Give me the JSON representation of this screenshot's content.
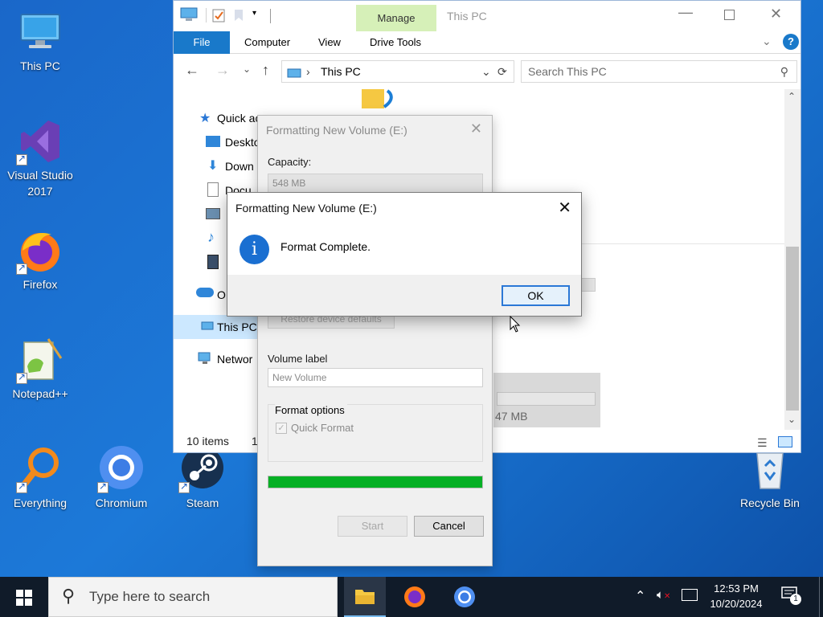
{
  "desktop": {
    "icons": [
      {
        "label": "This PC"
      },
      {
        "label": "Visual Studio\n2017"
      },
      {
        "label": "Firefox"
      },
      {
        "label": "Notepad++"
      },
      {
        "label": "Everything"
      },
      {
        "label": "Chromium"
      },
      {
        "label": "Steam"
      },
      {
        "label": "Recycle Bin"
      }
    ]
  },
  "explorer": {
    "title": "This PC",
    "manage_tab": "Manage",
    "tabs": [
      "File",
      "Computer",
      "View",
      "Drive Tools"
    ],
    "address": "This PC",
    "search_placeholder": "Search This PC",
    "nav": [
      "Quick ac",
      "Deskto",
      "Down",
      "Docu",
      "",
      "",
      "",
      "O",
      "This PC",
      "Networ"
    ],
    "status": "10 items",
    "status_extra": "1",
    "drive_text": "47 MB"
  },
  "format_dialog": {
    "title": "Formatting New Volume (E:)",
    "capacity_label": "Capacity:",
    "capacity_value": "548 MB",
    "restore_button": "Restore device defaults",
    "volume_label_label": "Volume label",
    "volume_label_value": "New Volume",
    "format_options_label": "Format options",
    "quick_format_label": "Quick Format",
    "quick_format_checked": true,
    "progress_fraction": 1.0,
    "start_button": "Start",
    "cancel_button": "Cancel"
  },
  "message_box": {
    "title": "Formatting New Volume (E:)",
    "message": "Format Complete.",
    "ok_button": "OK",
    "icon": "info-icon"
  },
  "taskbar": {
    "search_placeholder": "Type here to search",
    "time": "12:53 PM",
    "date": "10/20/2024",
    "notification_count": "1"
  },
  "colors": {
    "accent": "#1979ca",
    "progress": "#06b025",
    "taskbar": "#101b29"
  }
}
